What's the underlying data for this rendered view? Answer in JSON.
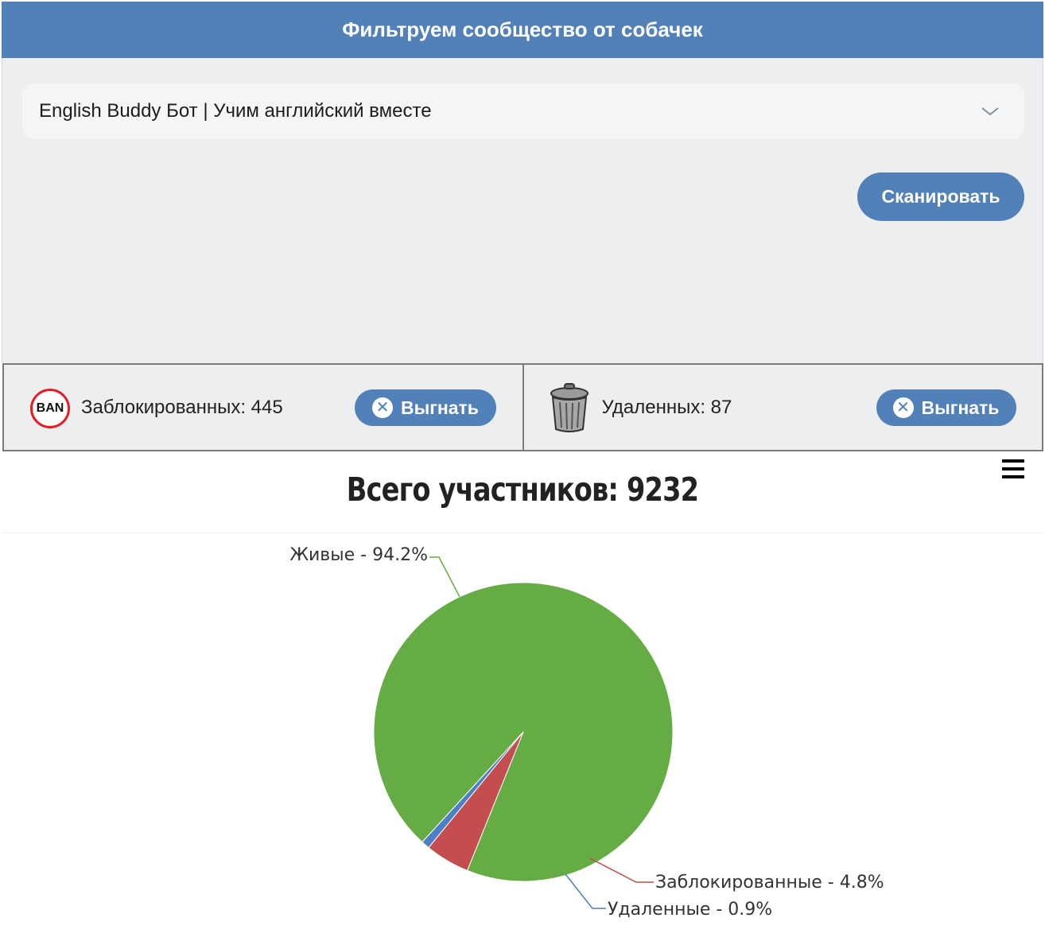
{
  "header": {
    "title": "Фильтруем сообщество от собачек"
  },
  "community_select": {
    "value": "English Buddy Бот | Учим английский вместе"
  },
  "scan_button": {
    "label": "Сканировать"
  },
  "stats": {
    "banned": {
      "icon_text": "BAN",
      "label": "Заблокированных: 445",
      "button": "Выгнать"
    },
    "deleted": {
      "label": "Удаленных: 87",
      "button": "Выгнать"
    }
  },
  "icons": {
    "ban": "ban-icon",
    "trash": "trash-icon",
    "close": "close-circle-icon",
    "chevron": "chevron-down-icon",
    "menu": "hamburger-menu-icon"
  },
  "colors": {
    "accent": "#5181b8",
    "panel": "#edeef0",
    "alive": "#65ac44",
    "banned": "#c44e4f",
    "deleted": "#4d7fc4"
  },
  "chart_data": {
    "type": "pie",
    "title": "Всего участников: 9232",
    "slices": [
      {
        "name": "Живые",
        "value": 94.2,
        "label": "Живые - 94.2%",
        "color": "#65ac44"
      },
      {
        "name": "Заблокированные",
        "value": 4.8,
        "label": "Заблокированные - 4.8%",
        "color": "#c44e4f"
      },
      {
        "name": "Удаленные",
        "value": 0.9,
        "label": "Удаленные - 0.9%",
        "color": "#4d7fc4"
      }
    ]
  }
}
